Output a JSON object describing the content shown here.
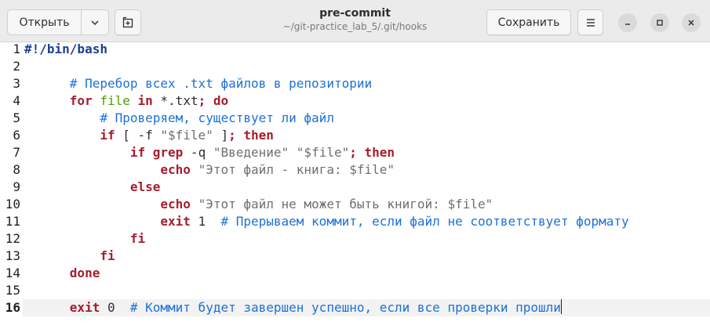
{
  "header": {
    "open_label": "Открыть",
    "title": "pre-commit",
    "subtitle": "~/git-practice_lab_5/.git/hooks",
    "save_label": "Сохранить"
  },
  "editor": {
    "current_line": 16,
    "lines": [
      {
        "n": "1",
        "tokens": [
          {
            "t": "#!/bin/bash",
            "c": "shebang"
          }
        ]
      },
      {
        "n": "2",
        "tokens": []
      },
      {
        "n": "3",
        "tokens": [
          {
            "t": "      ",
            "c": ""
          },
          {
            "t": "# Перебор всех .txt файлов в репозитории",
            "c": "comment"
          }
        ]
      },
      {
        "n": "4",
        "tokens": [
          {
            "t": "      ",
            "c": ""
          },
          {
            "t": "for",
            "c": "kw"
          },
          {
            "t": " ",
            "c": ""
          },
          {
            "t": "file",
            "c": "var"
          },
          {
            "t": " ",
            "c": ""
          },
          {
            "t": "in",
            "c": "kw"
          },
          {
            "t": " *.txt",
            "c": ""
          },
          {
            "t": ";",
            "c": "kw"
          },
          {
            "t": " ",
            "c": ""
          },
          {
            "t": "do",
            "c": "kw"
          }
        ]
      },
      {
        "n": "5",
        "tokens": [
          {
            "t": "          ",
            "c": ""
          },
          {
            "t": "# Проверяем, существует ли файл",
            "c": "comment"
          }
        ]
      },
      {
        "n": "6",
        "tokens": [
          {
            "t": "          ",
            "c": ""
          },
          {
            "t": "if",
            "c": "kw"
          },
          {
            "t": " [ -f ",
            "c": ""
          },
          {
            "t": "\"$file\"",
            "c": "str"
          },
          {
            "t": " ]",
            "c": ""
          },
          {
            "t": ";",
            "c": "kw"
          },
          {
            "t": " ",
            "c": ""
          },
          {
            "t": "then",
            "c": "kw"
          }
        ]
      },
      {
        "n": "7",
        "tokens": [
          {
            "t": "              ",
            "c": ""
          },
          {
            "t": "if",
            "c": "kw"
          },
          {
            "t": " ",
            "c": ""
          },
          {
            "t": "grep",
            "c": "builtin"
          },
          {
            "t": " -q ",
            "c": ""
          },
          {
            "t": "\"Введение\"",
            "c": "str"
          },
          {
            "t": " ",
            "c": ""
          },
          {
            "t": "\"$file\"",
            "c": "str"
          },
          {
            "t": ";",
            "c": "kw"
          },
          {
            "t": " ",
            "c": ""
          },
          {
            "t": "then",
            "c": "kw"
          }
        ]
      },
      {
        "n": "8",
        "tokens": [
          {
            "t": "                  ",
            "c": ""
          },
          {
            "t": "echo",
            "c": "builtin"
          },
          {
            "t": " ",
            "c": ""
          },
          {
            "t": "\"Этот файл - книга: $file\"",
            "c": "str"
          }
        ]
      },
      {
        "n": "9",
        "tokens": [
          {
            "t": "              ",
            "c": ""
          },
          {
            "t": "else",
            "c": "kw"
          }
        ]
      },
      {
        "n": "10",
        "tokens": [
          {
            "t": "                  ",
            "c": ""
          },
          {
            "t": "echo",
            "c": "builtin"
          },
          {
            "t": " ",
            "c": ""
          },
          {
            "t": "\"Этот файл не может быть книгой: $file\"",
            "c": "str"
          }
        ]
      },
      {
        "n": "11",
        "tokens": [
          {
            "t": "                  ",
            "c": ""
          },
          {
            "t": "exit",
            "c": "builtin"
          },
          {
            "t": " 1  ",
            "c": "num"
          },
          {
            "t": "# Прерываем коммит, если файл не соответствует формату",
            "c": "comment"
          }
        ]
      },
      {
        "n": "12",
        "tokens": [
          {
            "t": "              ",
            "c": ""
          },
          {
            "t": "fi",
            "c": "kw"
          }
        ]
      },
      {
        "n": "13",
        "tokens": [
          {
            "t": "          ",
            "c": ""
          },
          {
            "t": "fi",
            "c": "kw"
          }
        ]
      },
      {
        "n": "14",
        "tokens": [
          {
            "t": "      ",
            "c": ""
          },
          {
            "t": "done",
            "c": "kw"
          }
        ]
      },
      {
        "n": "15",
        "tokens": []
      },
      {
        "n": "16",
        "tokens": [
          {
            "t": "      ",
            "c": ""
          },
          {
            "t": "exit",
            "c": "builtin"
          },
          {
            "t": " 0  ",
            "c": "num"
          },
          {
            "t": "# Коммит будет завершен успешно, если все проверки прошли",
            "c": "comment"
          }
        ]
      }
    ]
  },
  "icons": {
    "open_dropdown": "chevron-down-icon",
    "new_tab": "new-tab-icon",
    "menu": "hamburger-menu-icon",
    "minimize": "minimize-icon",
    "maximize": "maximize-icon",
    "close": "close-icon"
  },
  "colors": {
    "keyword": "#a51d2d",
    "comment": "#1c71d8",
    "string": "#6f6f6f",
    "variable": "#4e9a06",
    "shebang": "#1c3f8c",
    "header_bg": "#ebebeb",
    "current_line_bg": "#f2f2f2"
  }
}
